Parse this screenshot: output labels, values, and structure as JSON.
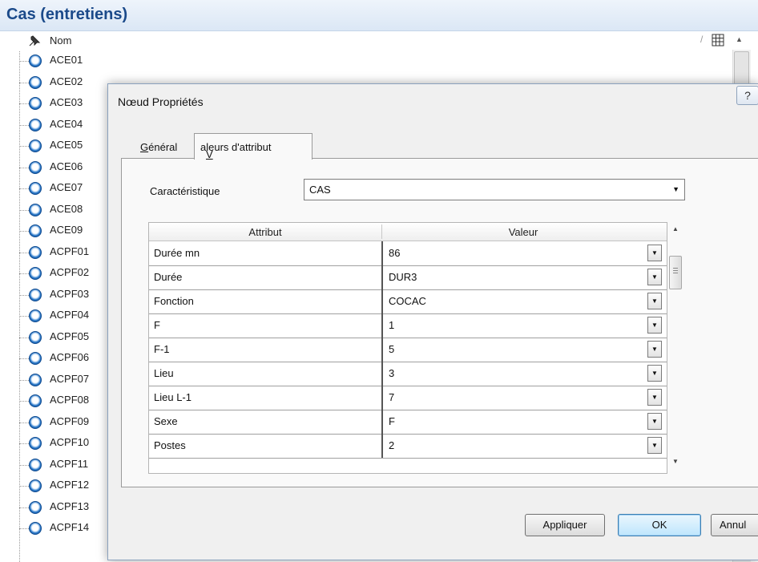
{
  "panel": {
    "title": "Cas (entretiens)",
    "column_header": "Nom",
    "column_sep": "/",
    "items": [
      "ACE01",
      "ACE02",
      "ACE03",
      "ACE04",
      "ACE05",
      "ACE06",
      "ACE07",
      "ACE08",
      "ACE09",
      "ACPF01",
      "ACPF02",
      "ACPF03",
      "ACPF04",
      "ACPF05",
      "ACPF06",
      "ACPF07",
      "ACPF08",
      "ACPF09",
      "ACPF10",
      "ACPF11",
      "ACPF12",
      "ACPF13",
      "ACPF14"
    ]
  },
  "dialog": {
    "title": "Nœud Propriétés",
    "help_label": "?",
    "tabs": [
      {
        "label": "Général",
        "active": false
      },
      {
        "label": "Valeurs d'attribut",
        "active": true
      }
    ],
    "caracteristique_label": "Caractéristique",
    "caracteristique_value": "CAS",
    "grid": {
      "headers": [
        "Attribut",
        "Valeur"
      ],
      "rows": [
        {
          "attribut": "Durée mn",
          "valeur": "86"
        },
        {
          "attribut": "Durée",
          "valeur": "DUR3"
        },
        {
          "attribut": "Fonction",
          "valeur": "COCAC"
        },
        {
          "attribut": "F",
          "valeur": "1"
        },
        {
          "attribut": "F-1",
          "valeur": "5"
        },
        {
          "attribut": "Lieu",
          "valeur": "3"
        },
        {
          "attribut": "Lieu L-1",
          "valeur": "7"
        },
        {
          "attribut": "Sexe",
          "valeur": "F"
        },
        {
          "attribut": "Postes",
          "valeur": "2"
        }
      ]
    },
    "buttons": {
      "appliquer": "Appliquer",
      "ok": "OK",
      "annuler": "Annul"
    }
  },
  "icons": {
    "node": "circle-node-icon",
    "pin": "pin-icon",
    "grid": "grid-icon",
    "dropdown": "chevron-down-icon"
  },
  "colors": {
    "panel_title": "#1b4a8a",
    "node_icon": "#2a78c8",
    "dialog_bg": "#f0f0f0",
    "ok_button": "#bee6fd"
  }
}
